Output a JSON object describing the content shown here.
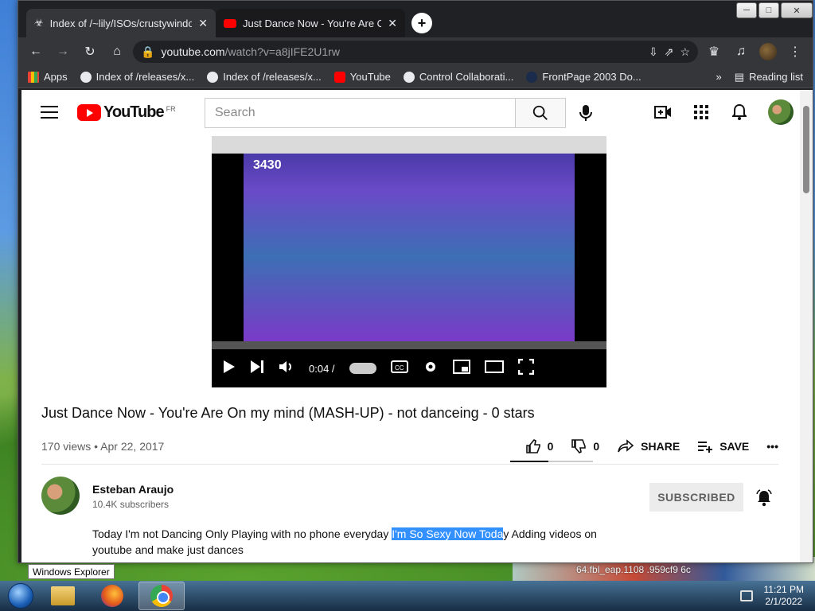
{
  "browser": {
    "tabs": [
      {
        "title": "Index of /~lily/ISOs/crustywindo",
        "active": true
      },
      {
        "title": "Just Dance Now - You're Are On",
        "active": false
      }
    ],
    "url_host": "youtube.com",
    "url_path": "/watch?v=a8jIFE2U1rw",
    "bookmarks": [
      {
        "label": "Apps"
      },
      {
        "label": "Index of /releases/x..."
      },
      {
        "label": "Index of /releases/x..."
      },
      {
        "label": "YouTube"
      },
      {
        "label": "Control Collaborati..."
      },
      {
        "label": "FrontPage 2003 Do..."
      }
    ],
    "more_bookmarks": "»",
    "reading_list": "Reading list"
  },
  "youtube": {
    "logo_text": "YouTube",
    "country": "FR",
    "search_placeholder": "Search"
  },
  "player": {
    "video_brand": "3430",
    "time": "0:04 /"
  },
  "video": {
    "title": "Just Dance Now - You're Are On my mind (MASH-UP) - not danceing - 0 stars",
    "views": "170 views • Apr 22, 2017",
    "likes": "0",
    "dislikes": "0",
    "share_label": "SHARE",
    "save_label": "SAVE",
    "more_label": "•••"
  },
  "channel": {
    "name": "Esteban Araujo",
    "subscribers": "10.4K subscribers",
    "subscribed_label": "SUBSCRIBED"
  },
  "description": {
    "part1": "Today I'm not Dancing Only Playing with no phone everyday ",
    "highlight": "I'm So Sexy Now Toda",
    "part2": "y Adding videos on youtube and make just dances"
  },
  "desktop": {
    "tooltip": "Windows Explorer",
    "hash_text": "64.fbl_eap.1108 .959cf9 6c"
  },
  "taskbar": {
    "time": "11:21 PM",
    "date": "2/1/2022"
  },
  "colors": {
    "yt_red": "#ff0000",
    "highlight": "#3390ff",
    "chrome_dark": "#202124"
  }
}
